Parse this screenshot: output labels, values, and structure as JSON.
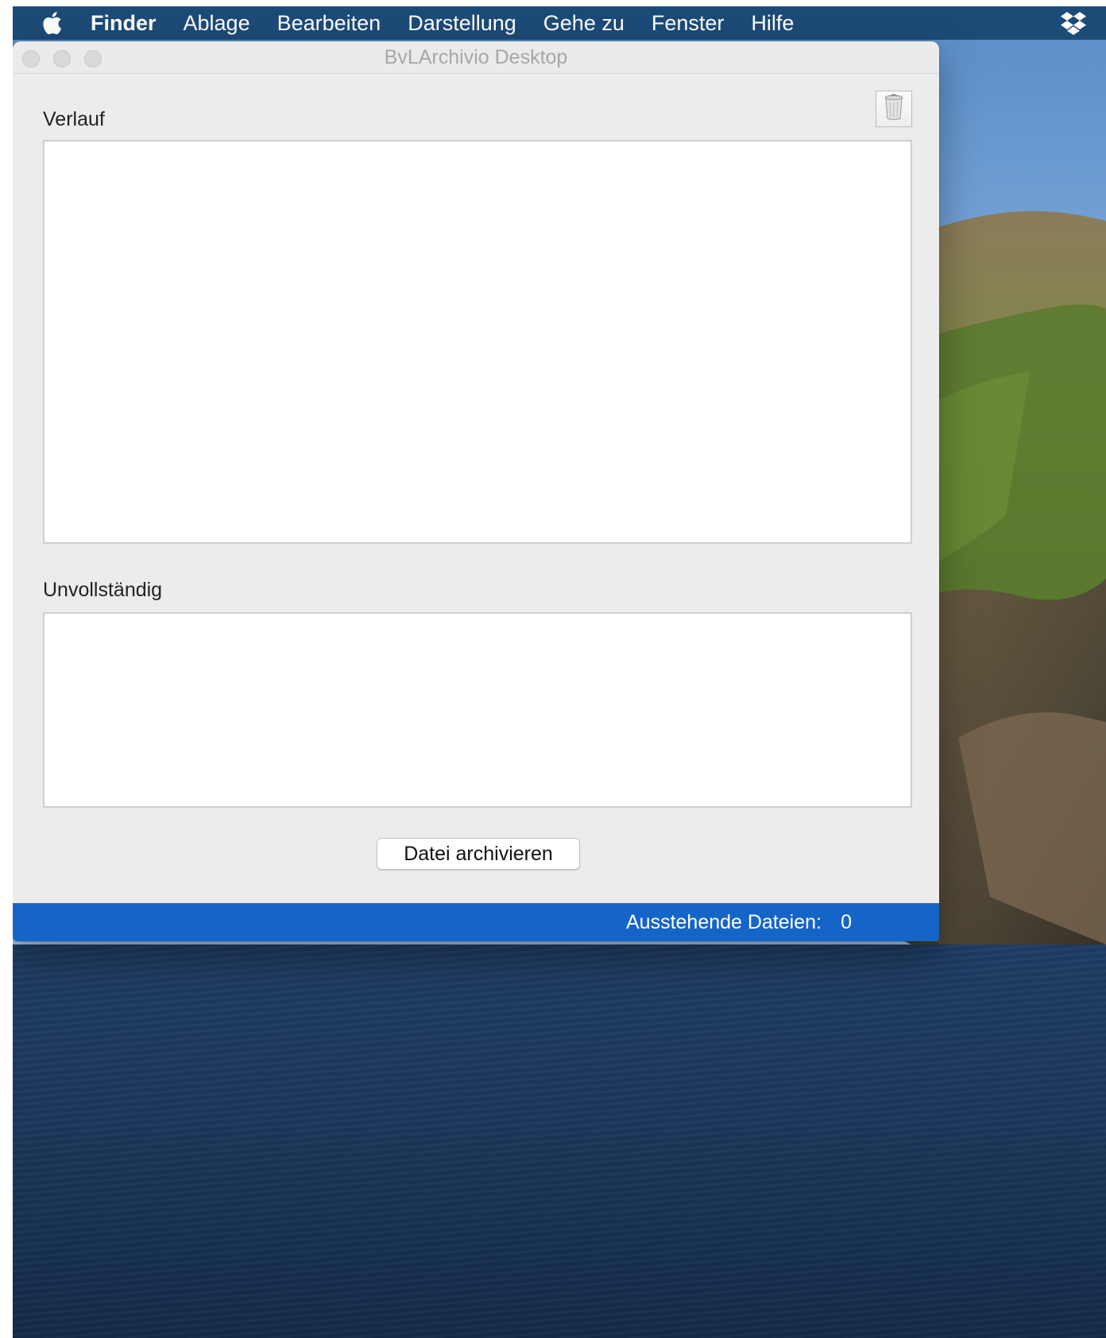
{
  "menubar": {
    "apple_icon": "apple-icon",
    "app_name": "Finder",
    "items": [
      "Ablage",
      "Bearbeiten",
      "Darstellung",
      "Gehe zu",
      "Fenster",
      "Hilfe"
    ],
    "status_icon": "dropbox-icon",
    "background": "#1d4b78"
  },
  "window": {
    "title": "BvLArchivio Desktop",
    "trash_icon": "trash-icon",
    "history_label": "Verlauf",
    "history_items": [],
    "incomplete_label": "Unvollständig",
    "incomplete_items": [],
    "archive_button_label": "Datei archivieren"
  },
  "statusbar": {
    "pending_label": "Ausstehende Dateien:",
    "pending_count": "0",
    "background": "#1565c8"
  }
}
